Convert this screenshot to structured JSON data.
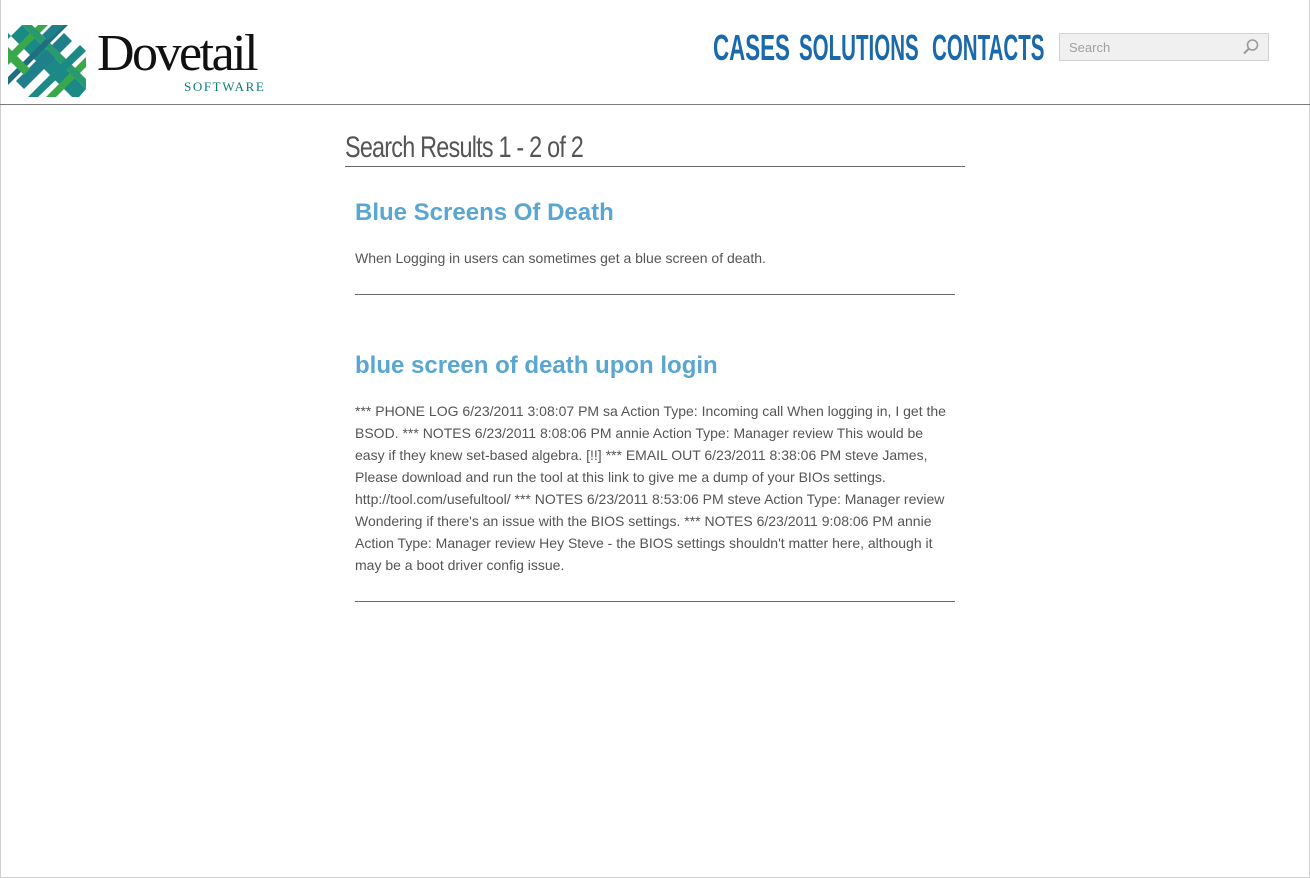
{
  "brand": {
    "name": "Dovetail",
    "sub": "SOFTWARE",
    "colors": {
      "teal": "#1b8a86",
      "green": "#39a84a",
      "dark": "#1f5f73"
    }
  },
  "nav": [
    {
      "label": "CASES"
    },
    {
      "label": "SOLUTIONS"
    },
    {
      "label": "CONTACTS"
    }
  ],
  "search": {
    "placeholder": "Search",
    "icon": "search-icon"
  },
  "results": {
    "title": "Search Results 1 - 2 of 2",
    "items": [
      {
        "title": "Blue Screens Of Death",
        "snippet": "When Logging in users can sometimes get a blue screen of death."
      },
      {
        "title": "blue screen of death upon login",
        "snippet": "*** PHONE LOG 6/23/2011 3:08:07 PM sa Action Type: Incoming call When logging in, I get the BSOD. *** NOTES 6/23/2011 8:08:06 PM annie Action Type: Manager review This would be easy if they knew set-based algebra. [!!] *** EMAIL OUT 6/23/2011 8:38:06 PM steve James, Please download and run the tool at this link to give me a dump of your BIOs settings. http://tool.com/usefultool/ *** NOTES 6/23/2011 8:53:06 PM steve Action Type: Manager review Wondering if there's an issue with the BIOS settings. *** NOTES 6/23/2011 9:08:06 PM annie Action Type: Manager review Hey Steve - the BIOS settings shouldn't matter here, although it may be a boot driver config issue."
      }
    ]
  },
  "colors": {
    "nav": "#1a6aab",
    "result_title": "#5aa6d2",
    "text": "#555555"
  }
}
